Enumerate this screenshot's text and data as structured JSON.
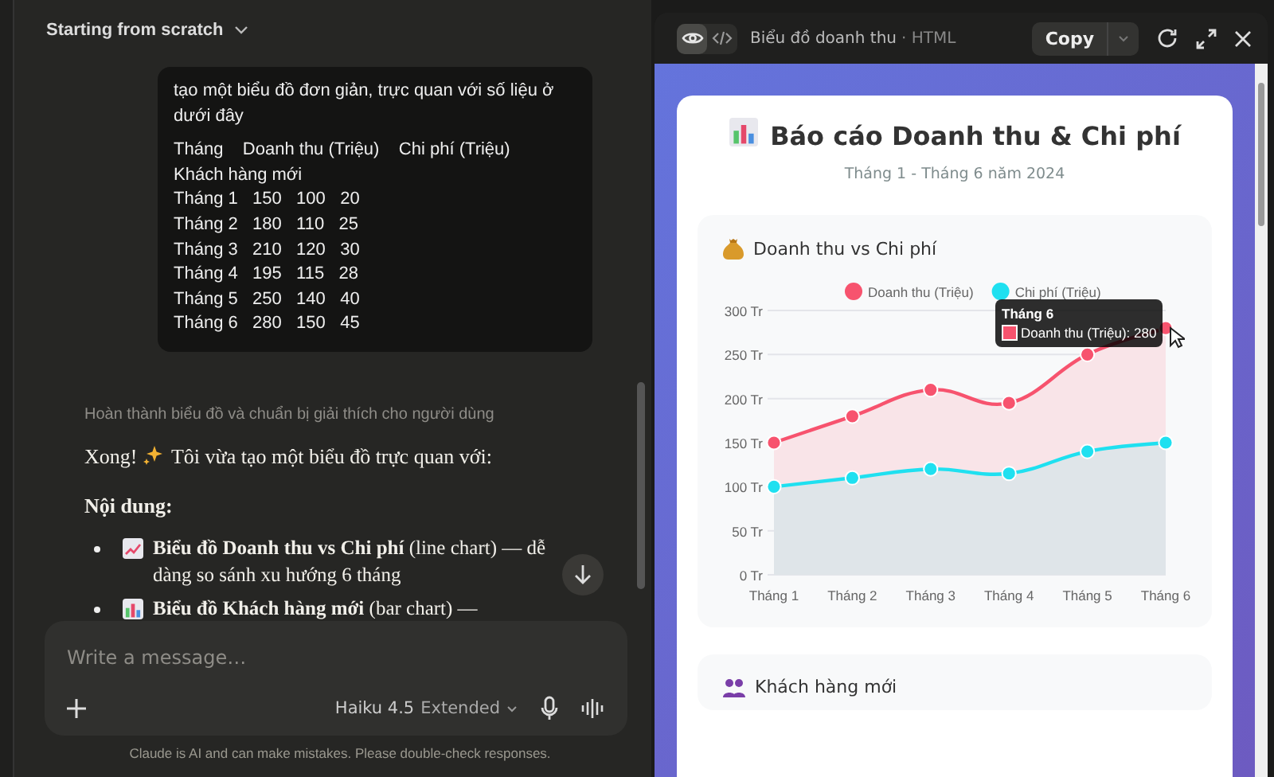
{
  "conversation": {
    "title": "Starting from scratch"
  },
  "user_message": {
    "text": "tạo một biểu đồ đơn giản, trực quan với số liệu ở dưới đây",
    "table_lines": [
      "Tháng    Doanh thu (Triệu)    Chi phí (Triệu)",
      "Khách hàng mới",
      "Tháng 1   150   100   20",
      "Tháng 2   180   110   25",
      "Tháng 3   210   120   30",
      "Tháng 4   195   115   28",
      "Tháng 5   250   140   40",
      "Tháng 6   280   150   45"
    ]
  },
  "assistant": {
    "status": "Hoàn thành biểu đồ và chuẩn bị giải thích cho người dùng",
    "blocks": [
      {
        "kind": "paragraph",
        "text": "Xong! Tôi vừa tạo một biểu đồ trực quan với:"
      },
      {
        "kind": "heading",
        "text": "Nội dung:"
      }
    ],
    "bullets": [
      "**Biểu đồ Doanh thu vs Chi phí** (line chart) — dễ dàng so sánh xu hướng 6 tháng",
      "**Biểu đồ Khách hàng mới** (bar chart) —"
    ]
  },
  "composer": {
    "placeholder": "Write a message…",
    "model": "Haiku 4.5",
    "mode": "Extended"
  },
  "disclaimer": "Claude is AI and can make mistakes. Please double-check responses.",
  "artifact": {
    "title": "Biểu đồ doanh thu",
    "type": "· HTML",
    "view_tabs": [
      {
        "kind": "preview",
        "selected": true
      },
      {
        "kind": "code",
        "selected": false
      }
    ],
    "copy": "Copy",
    "report": {
      "title": "Báo cáo Doanh thu & Chi phí",
      "subtitle": "Tháng 1 - Tháng 6 năm 2024",
      "sections": [
        {
          "title": "Doanh thu vs Chi phí",
          "chart_data": {
            "type": "area",
            "grid": true,
            "legend": true,
            "categories": [
              "Tháng 1",
              "Tháng 2",
              "Tháng 3",
              "Tháng 4",
              "Tháng 5",
              "Tháng 6"
            ],
            "series": [
              {
                "name": "Doanh thu (Triệu)",
                "color": "#f7536e",
                "marker": "circle",
                "values": [
                  150,
                  180,
                  210,
                  195,
                  250,
                  280
                ]
              },
              {
                "name": "Chi phí (Triệu)",
                "color": "#1fe0f0",
                "marker": "circle",
                "values": [
                  100,
                  110,
                  120,
                  115,
                  140,
                  150
                ]
              }
            ],
            "ylim": [
              0,
              300
            ],
            "yticks": [
              {
                "value": 0,
                "label": "0 Tr"
              },
              {
                "value": 50,
                "label": "50 Tr"
              },
              {
                "value": 100,
                "label": "100 Tr"
              },
              {
                "value": 150,
                "label": "150 Tr"
              },
              {
                "value": 200,
                "label": "200 Tr"
              },
              {
                "value": 250,
                "label": "250 Tr"
              },
              {
                "value": 300,
                "label": "300 Tr"
              }
            ]
          },
          "tooltip": {
            "title": "Tháng 6",
            "label": "Doanh thu (Triệu): 280"
          }
        },
        {
          "title": "Khách hàng mới"
        }
      ]
    }
  }
}
